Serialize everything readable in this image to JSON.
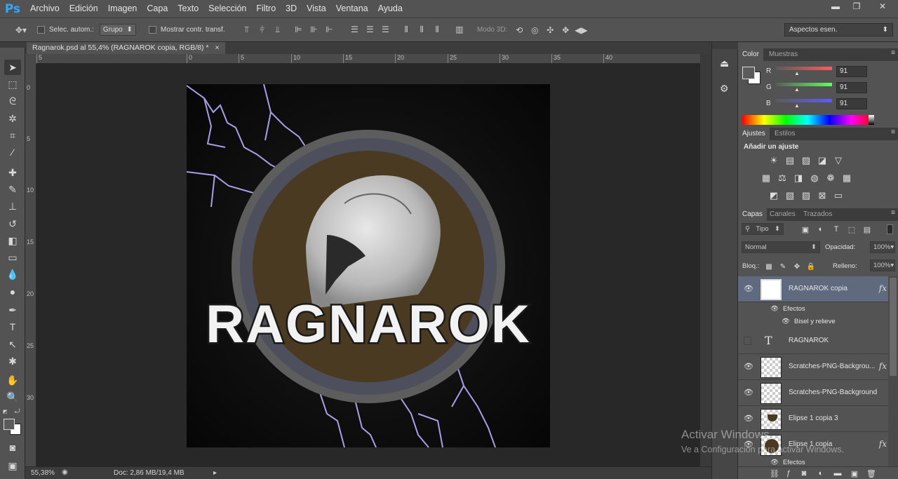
{
  "app": {
    "logo": "Ps"
  },
  "menu": [
    "Archivo",
    "Edición",
    "Imagen",
    "Capa",
    "Texto",
    "Selección",
    "Filtro",
    "3D",
    "Vista",
    "Ventana",
    "Ayuda"
  ],
  "window_controls": {
    "minimize_icon": "minimize-icon",
    "restore_icon": "restore-icon",
    "close_icon": "close-icon",
    "minimize": "▬",
    "restore": "❐",
    "close": "✕"
  },
  "options": {
    "auto_select_label": "Selec. autom.:",
    "auto_select_value": "Grupo",
    "transform_label": "Mostrar contr. transf.",
    "mode3d_label": "Modo 3D:",
    "workspace": "Aspectos esen."
  },
  "document": {
    "tab_title": "Ragnarok.psd al 55,4% (RAGNAROK copia, RGB/8) *",
    "close": "×"
  },
  "artwork_text": "RAGNAROK",
  "ruler": {
    "top": [
      "5",
      "0",
      "5",
      "10",
      "15",
      "20",
      "25",
      "30",
      "35",
      "40"
    ],
    "left": [
      "0",
      "5",
      "10",
      "15",
      "20",
      "25",
      "30"
    ]
  },
  "status": {
    "zoom": "55,38%",
    "doc": "Doc: 2,86 MB/19,4 MB"
  },
  "color_panel": {
    "tabs": [
      "Color",
      "Muestras"
    ],
    "r_label": "R",
    "g_label": "G",
    "b_label": "B",
    "r": "91",
    "g": "91",
    "b": "91",
    "fg_color": "#5b5b5b"
  },
  "adjust_panel": {
    "tabs": [
      "Ajustes",
      "Estilos"
    ],
    "title": "Añadir un ajuste"
  },
  "layers_panel": {
    "tabs": [
      "Capas",
      "Canales",
      "Trazados"
    ],
    "filter_kind": "Tipo",
    "blend_mode": "Normal",
    "opacity_label": "Opacidad:",
    "opacity": "100%",
    "lock_label": "Bloq.:",
    "fill_label": "Relleno:",
    "fill": "100%",
    "layers": [
      {
        "name": "RAGNAROK copia",
        "fx": "fx",
        "visible": true,
        "active": true
      },
      {
        "name": "RAGNAROK",
        "fx": "",
        "visible": false,
        "active": false
      },
      {
        "name": "Scratches-PNG-Backgrou...",
        "fx": "fx",
        "visible": true,
        "active": false
      },
      {
        "name": "Scratches-PNG-Background ...",
        "fx": "",
        "visible": true,
        "active": false
      },
      {
        "name": "Elipse 1 copia 3",
        "fx": "",
        "visible": true,
        "active": false
      },
      {
        "name": "Elipse 1 copia",
        "fx": "fx",
        "visible": true,
        "active": false
      }
    ],
    "effects_label": "Efectos",
    "bevel_label": "Bisel y relieve",
    "effects_label2": "Efectos"
  },
  "watermark": {
    "line1": "Activar Windows",
    "line2": "Ve a Configuración para activar Windows."
  }
}
